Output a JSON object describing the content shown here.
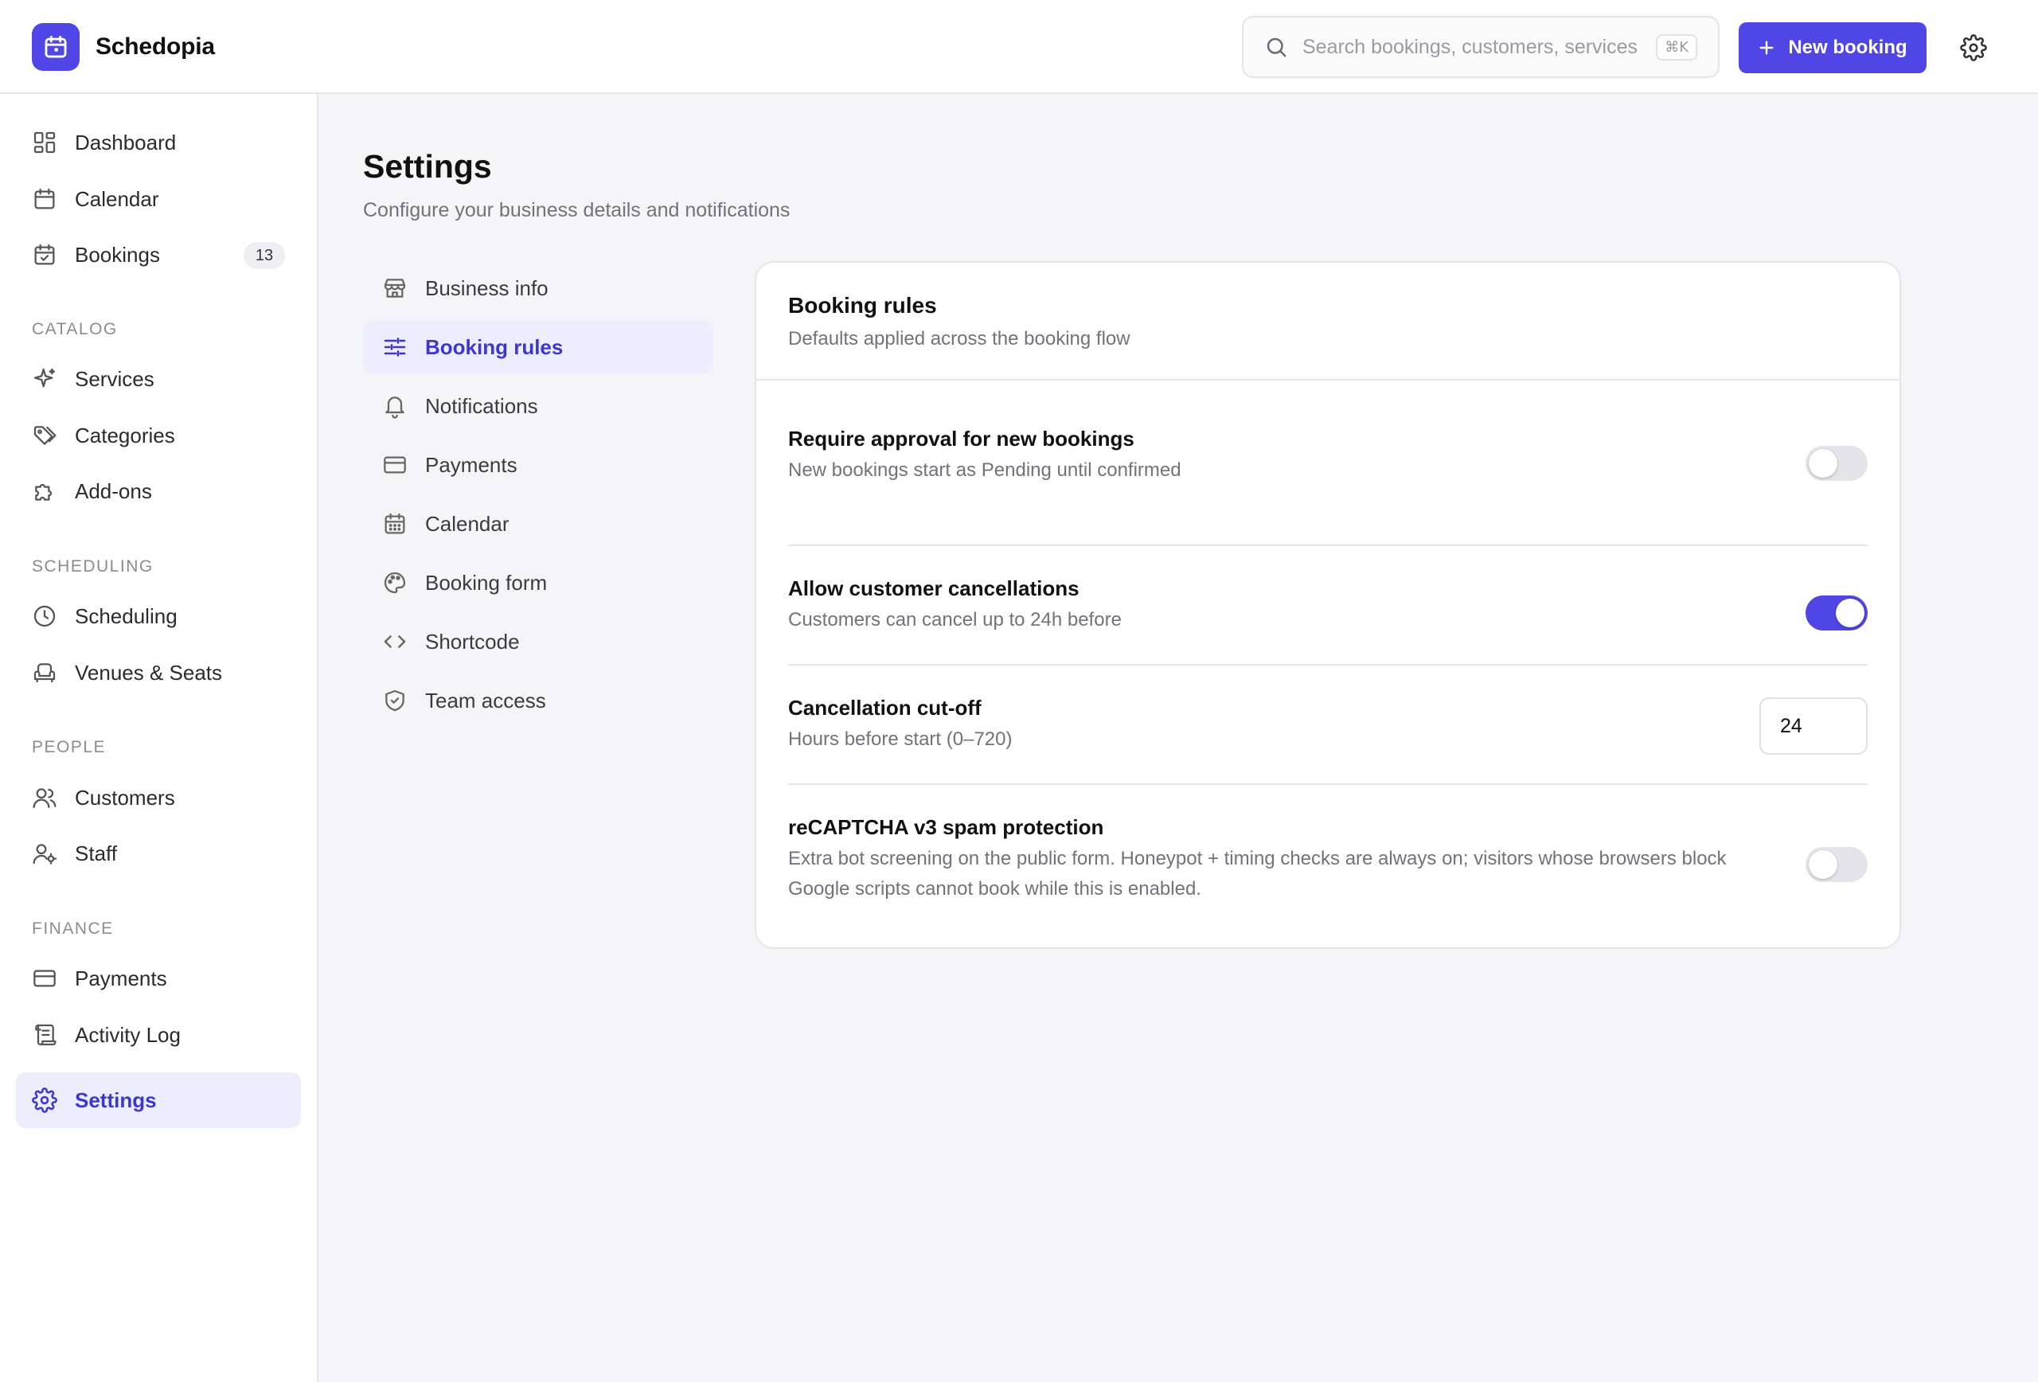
{
  "app": {
    "name": "Schedopia"
  },
  "header": {
    "search_placeholder": "Search bookings, customers, services",
    "search_shortcut": "⌘K",
    "new_booking_label": "New booking"
  },
  "sidebar": {
    "items_top": [
      {
        "label": "Dashboard",
        "icon": "dashboard-icon"
      },
      {
        "label": "Calendar",
        "icon": "calendar-icon"
      },
      {
        "label": "Bookings",
        "icon": "calendar-check-icon",
        "badge": "13"
      }
    ],
    "sections": [
      {
        "label": "CATALOG",
        "items": [
          {
            "label": "Services",
            "icon": "sparkle-icon"
          },
          {
            "label": "Categories",
            "icon": "tag-icon"
          },
          {
            "label": "Add-ons",
            "icon": "puzzle-icon"
          }
        ]
      },
      {
        "label": "SCHEDULING",
        "items": [
          {
            "label": "Scheduling",
            "icon": "clock-icon"
          },
          {
            "label": "Venues & Seats",
            "icon": "armchair-icon"
          }
        ]
      },
      {
        "label": "PEOPLE",
        "items": [
          {
            "label": "Customers",
            "icon": "users-icon"
          },
          {
            "label": "Staff",
            "icon": "user-gear-icon"
          }
        ]
      },
      {
        "label": "FINANCE",
        "items": [
          {
            "label": "Payments",
            "icon": "credit-card-icon"
          },
          {
            "label": "Activity Log",
            "icon": "scroll-icon"
          }
        ]
      }
    ],
    "settings_label": "Settings"
  },
  "page": {
    "title": "Settings",
    "subtitle": "Configure your business details and notifications"
  },
  "settings_nav": [
    {
      "label": "Business info",
      "icon": "store-icon"
    },
    {
      "label": "Booking rules",
      "icon": "sliders-icon",
      "active": true
    },
    {
      "label": "Notifications",
      "icon": "bell-icon"
    },
    {
      "label": "Payments",
      "icon": "credit-card-icon"
    },
    {
      "label": "Calendar",
      "icon": "calendar-grid-icon"
    },
    {
      "label": "Booking form",
      "icon": "palette-icon"
    },
    {
      "label": "Shortcode",
      "icon": "code-icon"
    },
    {
      "label": "Team access",
      "icon": "shield-check-icon"
    }
  ],
  "booking_rules": {
    "title": "Booking rules",
    "subtitle": "Defaults applied across the booking flow",
    "rows": [
      {
        "title": "Require approval for new bookings",
        "desc": "New bookings start as Pending until confirmed",
        "enabled": false
      },
      {
        "title": "Allow customer cancellations",
        "desc": "Customers can cancel up to 24h before",
        "enabled": true
      },
      {
        "title": "Cancellation cut-off",
        "desc": "Hours before start (0–720)",
        "value": "24"
      },
      {
        "title": "reCAPTCHA v3 spam protection",
        "desc_line1": "Extra bot screening on the public form. Honeypot + timing checks are always on; visitors whose browsers block",
        "desc_line2": "Google scripts cannot book while this is enabled.",
        "enabled": false
      }
    ]
  },
  "colors": {
    "accent": "#4f46e5",
    "accent_soft": "#eceefe",
    "background": "#f5f5f8"
  }
}
